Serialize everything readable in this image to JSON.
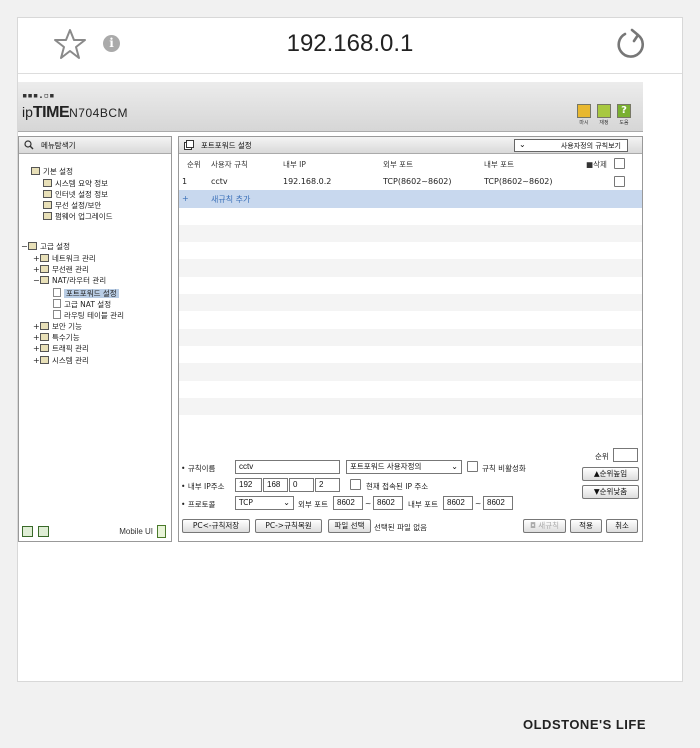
{
  "browser": {
    "url": "192.168.0.1"
  },
  "router": {
    "logo_dots": "▪▪▪.▫▪",
    "logo_prefix": "ip",
    "logo_brand": "TIME",
    "logo_model": "N704BCM",
    "toolbar": [
      {
        "label": "마시",
        "icon": "refresh-icon",
        "color": "#e8b830"
      },
      {
        "label": "재정",
        "icon": "save-icon",
        "color": "#a8c840"
      },
      {
        "label": "도움",
        "icon": "help-icon",
        "color": "#7ab030"
      }
    ]
  },
  "menu": {
    "title": "메뉴탐색기",
    "basic_group": "기본 설정",
    "basic_items": [
      "시스템 요약 정보",
      "인터넷 설정 정보",
      "무선 설정/보안",
      "펌웨어 업그레이드"
    ],
    "advanced_group": "고급 설정",
    "adv_items": [
      {
        "tog": "+",
        "label": "네트워크 관리"
      },
      {
        "tog": "+",
        "label": "무선랜 관리"
      },
      {
        "tog": "−",
        "label": "NAT/라우터 관리"
      }
    ],
    "nat_items": [
      "포트포워드 설정",
      "고급 NAT 설정",
      "라우팅 테이블 관리"
    ],
    "more_items": [
      {
        "tog": "+",
        "label": "보안 기능"
      },
      {
        "tog": "+",
        "label": "특수기능"
      },
      {
        "tog": "+",
        "label": "트래픽 관리"
      },
      {
        "tog": "+",
        "label": "시스템 관리"
      }
    ],
    "mobile_ui": "Mobile UI"
  },
  "portforward": {
    "title": "포트포워드 설정",
    "view_select": "사용자정의 규칙보기",
    "columns": {
      "order": "순위",
      "name": "사용자 규칙",
      "internal_ip": "내부 IP",
      "external_port": "외부 포트",
      "internal_port": "내부 포트",
      "delete": "■삭제"
    },
    "rules": [
      {
        "order": "1",
        "name": "cctv",
        "internal_ip": "192.168.0.2",
        "external_port": "TCP(8602~8602)",
        "internal_port": "TCP(8602~8602)"
      }
    ],
    "add_plus": "+",
    "add_label": "새규칙 추가",
    "form": {
      "rule_name_label": "규칙이름",
      "rule_name_value": "cctv",
      "rule_type": "포트포워드 사용자정의",
      "disable_label": "규칙 비활성화",
      "ip_label": "내부 IP주소",
      "ip1": "192",
      "ip2": "168",
      "ip3": "0",
      "ip4": "2",
      "current_ip_label": "현재 접속된 IP 주소",
      "protocol_label": "프로토콜",
      "protocol_value": "TCP",
      "ext_port_label": "외부 포트",
      "ext_from": "8602",
      "ext_to": "8602",
      "int_port_label": "내부 포트",
      "int_from": "8602",
      "int_to": "8602",
      "tilde": "~",
      "order_label": "순위",
      "order_value": "",
      "btn_up": "▲순위높임",
      "btn_down": "▼순위낮춤",
      "btn_save_pc": "PC<-규칙저장",
      "btn_restore_pc": "PC->규칙복원",
      "btn_file": "파일 선택",
      "file_status": "선택된 파일 없음",
      "btn_new": "◘ 새규칙",
      "btn_apply": "적용",
      "btn_cancel": "취소"
    }
  },
  "watermark": "OLDSTONE'S LIFE"
}
